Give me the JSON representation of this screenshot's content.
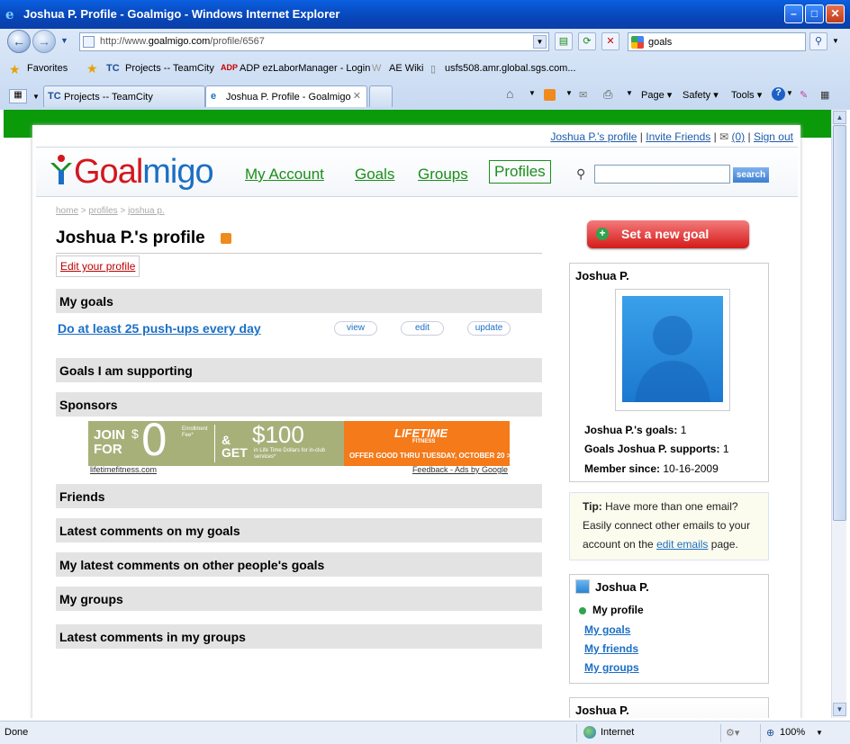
{
  "window": {
    "title": "Joshua P. Profile - Goalmigo - Windows Internet Explorer"
  },
  "toolbar": {
    "url_prefix": "http://www.",
    "url_domain": "goalmigo.com",
    "url_path": "/profile/6567",
    "search_value": "goals"
  },
  "favorites": {
    "label": "Favorites",
    "items": [
      "Projects -- TeamCity",
      "ADP ezLaborManager - Login",
      "AE Wiki",
      "usfs508.amr.global.sgs.com..."
    ]
  },
  "tabs": [
    {
      "label": "Projects -- TeamCity"
    },
    {
      "label": "Joshua P. Profile - Goalmigo"
    }
  ],
  "commands": {
    "page": "Page",
    "safety": "Safety",
    "tools": "Tools"
  },
  "site": {
    "toplinks": {
      "profile": "Joshua P.'s profile",
      "invite": "Invite Friends",
      "messages": "(0)",
      "signout": "Sign out"
    },
    "logo_part1": "Goal",
    "logo_part2": "migo",
    "nav": {
      "account": "My Account",
      "goals": "Goals",
      "groups": "Groups",
      "profiles": "Profiles"
    },
    "search_button": "search",
    "breadcrumb": {
      "home": "home",
      "profiles": "profiles",
      "current": "joshua p."
    },
    "page_title": "Joshua P.'s profile",
    "edit_profile": "Edit your profile",
    "sections": {
      "my_goals": "My goals",
      "supporting": "Goals I am supporting",
      "sponsors": "Sponsors",
      "friends": "Friends",
      "latest_comments": "Latest comments on my goals",
      "my_latest_comments": "My latest comments on other people's goals",
      "my_groups": "My groups",
      "group_comments": "Latest comments in my groups"
    },
    "goal": {
      "title": "Do at least 25 push-ups every day",
      "view": "view",
      "edit": "edit",
      "update": "update"
    },
    "ad": {
      "join": "JOIN",
      "for": "FOR",
      "zero_dollar": "$",
      "zero": "0",
      "enrollment": "Enrollment Fee*",
      "amp_get": "& GET",
      "hundred": "$100",
      "detail": "in Life Time Dollars for in-club services*",
      "brand": "LIFETIME",
      "brand_sub": "FITNESS",
      "offer": "OFFER GOOD THRU TUESDAY, OCTOBER 20 >>",
      "domain": "lifetimefitness.com",
      "feedback": "Feedback - Ads by Google"
    },
    "sidebar": {
      "set_goal": "Set a new goal",
      "user_name": "Joshua P.",
      "stat_goals_label": "Joshua P.'s goals:",
      "stat_goals_value": "1",
      "stat_supports_label": "Goals Joshua P. supports:",
      "stat_supports_value": "1",
      "stat_member_label": "Member since:",
      "stat_member_value": "10-16-2009",
      "tip_label": "Tip:",
      "tip_text1": "Have more than one email?",
      "tip_text2": "Easily connect other emails to your",
      "tip_text3": "account on the",
      "tip_link": "edit emails",
      "tip_text4": "page.",
      "menu_user": "Joshua P.",
      "menu_profile": "My profile",
      "menu_goals": "My goals",
      "menu_friends": "My friends",
      "menu_groups": "My groups",
      "bottom_user": "Joshua P."
    }
  },
  "status": {
    "left": "Done",
    "zone": "Internet",
    "zoom": "100%"
  }
}
